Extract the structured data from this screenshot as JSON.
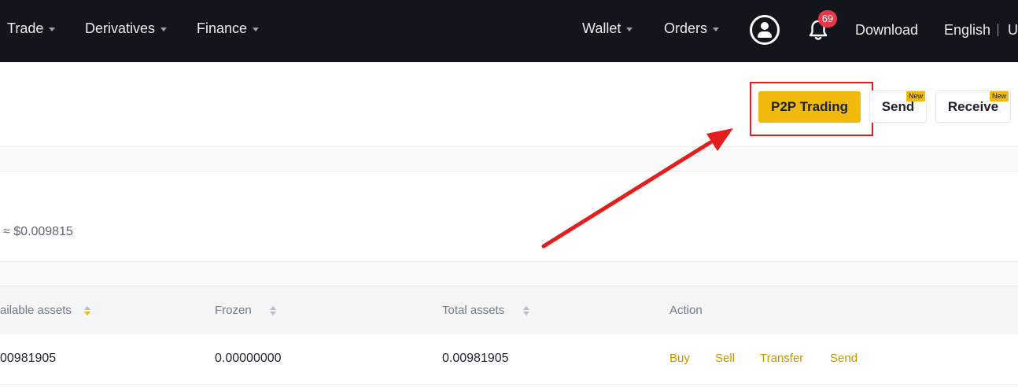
{
  "nav": {
    "left": [
      {
        "label": "Trade"
      },
      {
        "label": "Derivatives"
      },
      {
        "label": "Finance"
      }
    ],
    "wallet": "Wallet",
    "orders": "Orders",
    "notifications_count": "69",
    "download": "Download",
    "language": "English",
    "currency_cut": "U",
    "icons": {
      "account": "user-circle-icon",
      "notifications": "bell-icon",
      "dropdown": "caret-down-icon"
    }
  },
  "header": {
    "p2p_label": "P2P Trading",
    "send_label": "Send",
    "receive_label": "Receive",
    "new_tag": "New"
  },
  "balance": {
    "usd_equivalent": "≈ $0.009815"
  },
  "table": {
    "headers": [
      "ailable assets",
      "Frozen",
      "Total assets",
      "Action"
    ],
    "rows": [
      {
        "available": "00981905",
        "frozen": "0.00000000",
        "total": "0.00981905",
        "actions": [
          "Buy",
          "Sell",
          "Transfer",
          "Send"
        ]
      }
    ]
  },
  "colors": {
    "nav_bg": "#12161c",
    "accent": "#f0b90b",
    "action_link": "#c99400",
    "annotation": "#e41e1e",
    "badge": "#e8374a"
  }
}
